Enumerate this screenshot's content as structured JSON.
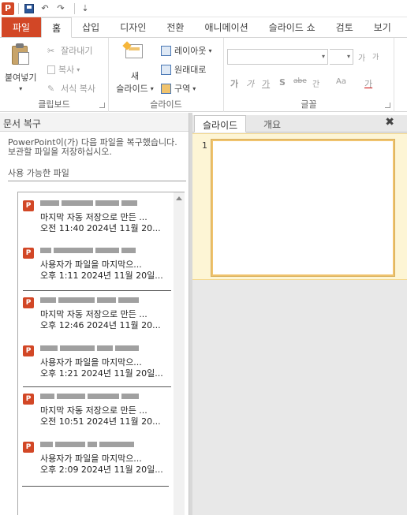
{
  "qat": {
    "app_logo": "P",
    "icons": [
      "save-icon",
      "undo-icon",
      "redo-icon",
      "customize-icon"
    ],
    "undo_glyph": "↶",
    "redo_glyph": "↷",
    "customize_glyph": "⇣"
  },
  "tabs": [
    {
      "label": "파일",
      "name": "tab-file"
    },
    {
      "label": "홈",
      "name": "tab-home",
      "active": true
    },
    {
      "label": "삽입",
      "name": "tab-insert"
    },
    {
      "label": "디자인",
      "name": "tab-design"
    },
    {
      "label": "전환",
      "name": "tab-transitions"
    },
    {
      "label": "애니메이션",
      "name": "tab-animations"
    },
    {
      "label": "슬라이드 쇼",
      "name": "tab-slideshow"
    },
    {
      "label": "검토",
      "name": "tab-review"
    },
    {
      "label": "보기",
      "name": "tab-view"
    }
  ],
  "ribbon": {
    "clipboard": {
      "paste_label": "붙여넣기",
      "cut_label": "잘라내기",
      "copy_label": "복사",
      "format_painter_label": "서식 복사",
      "group_label": "클립보드"
    },
    "slides": {
      "new_slide_label_1": "새",
      "new_slide_label_2": "슬라이드",
      "layout_label": "레이아웃",
      "reset_label": "원래대로",
      "section_label": "구역",
      "group_label": "슬라이드"
    },
    "font": {
      "group_label": "글꼴",
      "font_name": "",
      "font_size": "",
      "bold": "가",
      "italic": "가",
      "underline": "가",
      "shadow": "S",
      "strike": "abe",
      "spacing": "간",
      "case": "Aa",
      "color": "가",
      "grow": "가",
      "shrink": "가"
    }
  },
  "recovery": {
    "title": "문서 복구",
    "description": "PowerPoint이(가) 다음 파일을 복구했습니다. 보관할 파일을 저장하십시오.",
    "available_label": "사용 가능한 파일",
    "files": [
      {
        "desc": "마지막 자동 저장으로 만든 ...",
        "date": "오전 11:40 2024년 11월 20..."
      },
      {
        "desc": "사용자가 파일을 마지막으...",
        "date": "오후 1:11 2024년 11월 20일..."
      },
      {
        "desc": "마지막 자동 저장으로 만든 ...",
        "date": "오후 12:46 2024년 11월 20..."
      },
      {
        "desc": "사용자가 파일을 마지막으...",
        "date": "오후 1:21 2024년 11월 20일..."
      },
      {
        "desc": "마지막 자동 저장으로 만든 ...",
        "date": "오전 10:51 2024년 11월 20..."
      },
      {
        "desc": "사용자가 파일을 마지막으...",
        "date": "오후 2:09 2024년 11월 20일..."
      }
    ]
  },
  "slides_pane": {
    "tab_slides": "슬라이드",
    "tab_outline": "개요",
    "close_glyph": "✖",
    "slide_number": "1"
  },
  "colors": {
    "accent": "#d24726",
    "selection": "#fdf5d5",
    "selection_border": "#f0c36d"
  }
}
